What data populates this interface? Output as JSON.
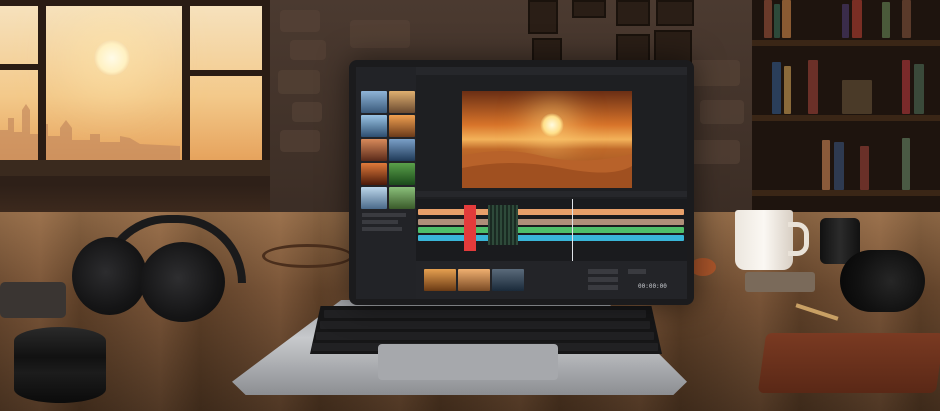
{
  "scene": {
    "description_colors": {
      "sky": "#f3c98a",
      "sun": "#fff1c2",
      "table_wood": "#6b4a30",
      "laptop_body": "#c7c9cc",
      "ui_background": "#1e1f22",
      "accent_orange": "#e8a06a",
      "accent_green": "#4fbf6a",
      "accent_cyan": "#39b6d8",
      "accent_red": "#e33b3b"
    }
  },
  "editor": {
    "timecode": "00:00:00"
  }
}
